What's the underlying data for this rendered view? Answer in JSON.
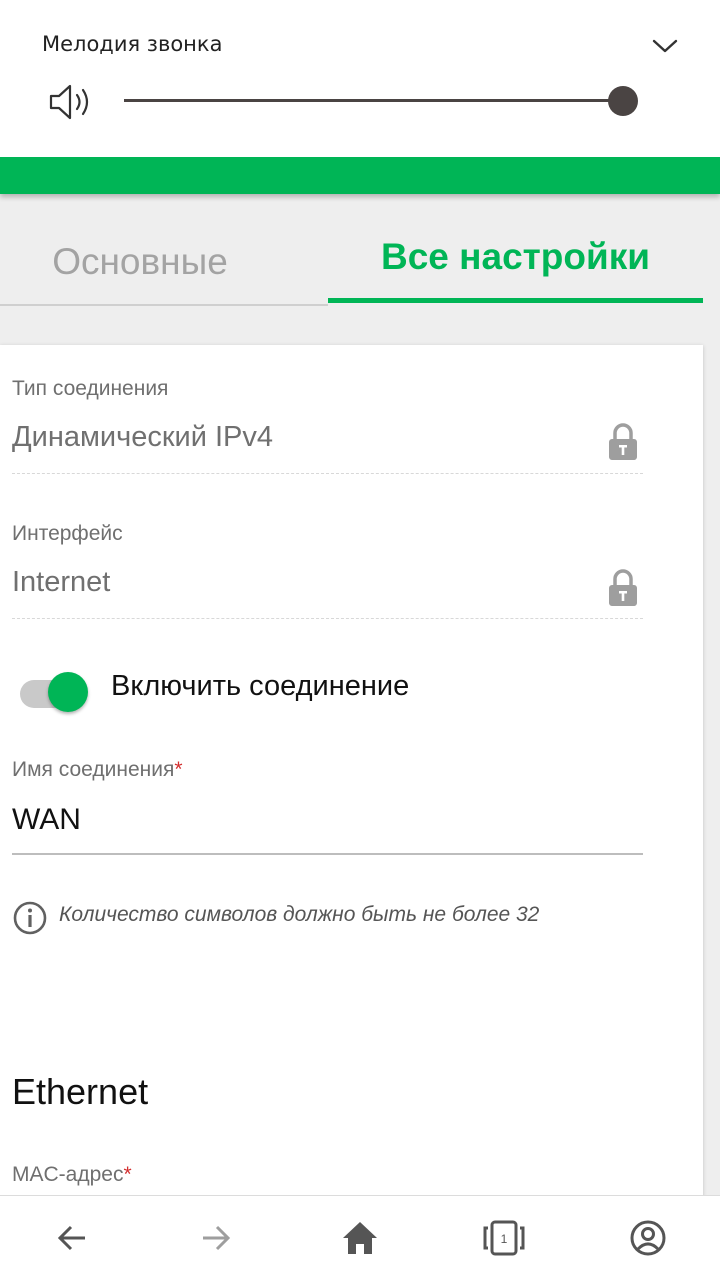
{
  "volume_panel": {
    "title": "Мелодия звонка",
    "level": 1.0,
    "icons": {
      "speaker": "speaker-icon",
      "collapse": "chevron-down-icon"
    }
  },
  "tabs": [
    {
      "label": "Основные",
      "active": false
    },
    {
      "label": "Все настройки",
      "active": true
    }
  ],
  "form": {
    "connection_type": {
      "label": "Тип соединения",
      "value": "Динамический IPv4",
      "locked": true
    },
    "interface": {
      "label": "Интерфейс",
      "value": "Internet",
      "locked": true
    },
    "enable_connection": {
      "label": "Включить соединение",
      "enabled": true
    },
    "connection_name": {
      "label": "Имя соединения",
      "required_mark": "*",
      "value": "WAN"
    },
    "hint": "Количество символов должно быть не более 32",
    "ethernet_section": "Ethernet",
    "mac_address": {
      "label": "MAC-адрес",
      "required_mark": "*"
    }
  },
  "bottom_nav": {
    "items": [
      {
        "icon": "back-arrow-icon"
      },
      {
        "icon": "forward-arrow-icon"
      },
      {
        "icon": "home-icon"
      },
      {
        "icon": "tabs-icon",
        "count": "1"
      },
      {
        "icon": "account-icon"
      }
    ]
  },
  "colors": {
    "accent": "#00b556",
    "required": "#d32f2f",
    "slider": "#4a4443"
  }
}
